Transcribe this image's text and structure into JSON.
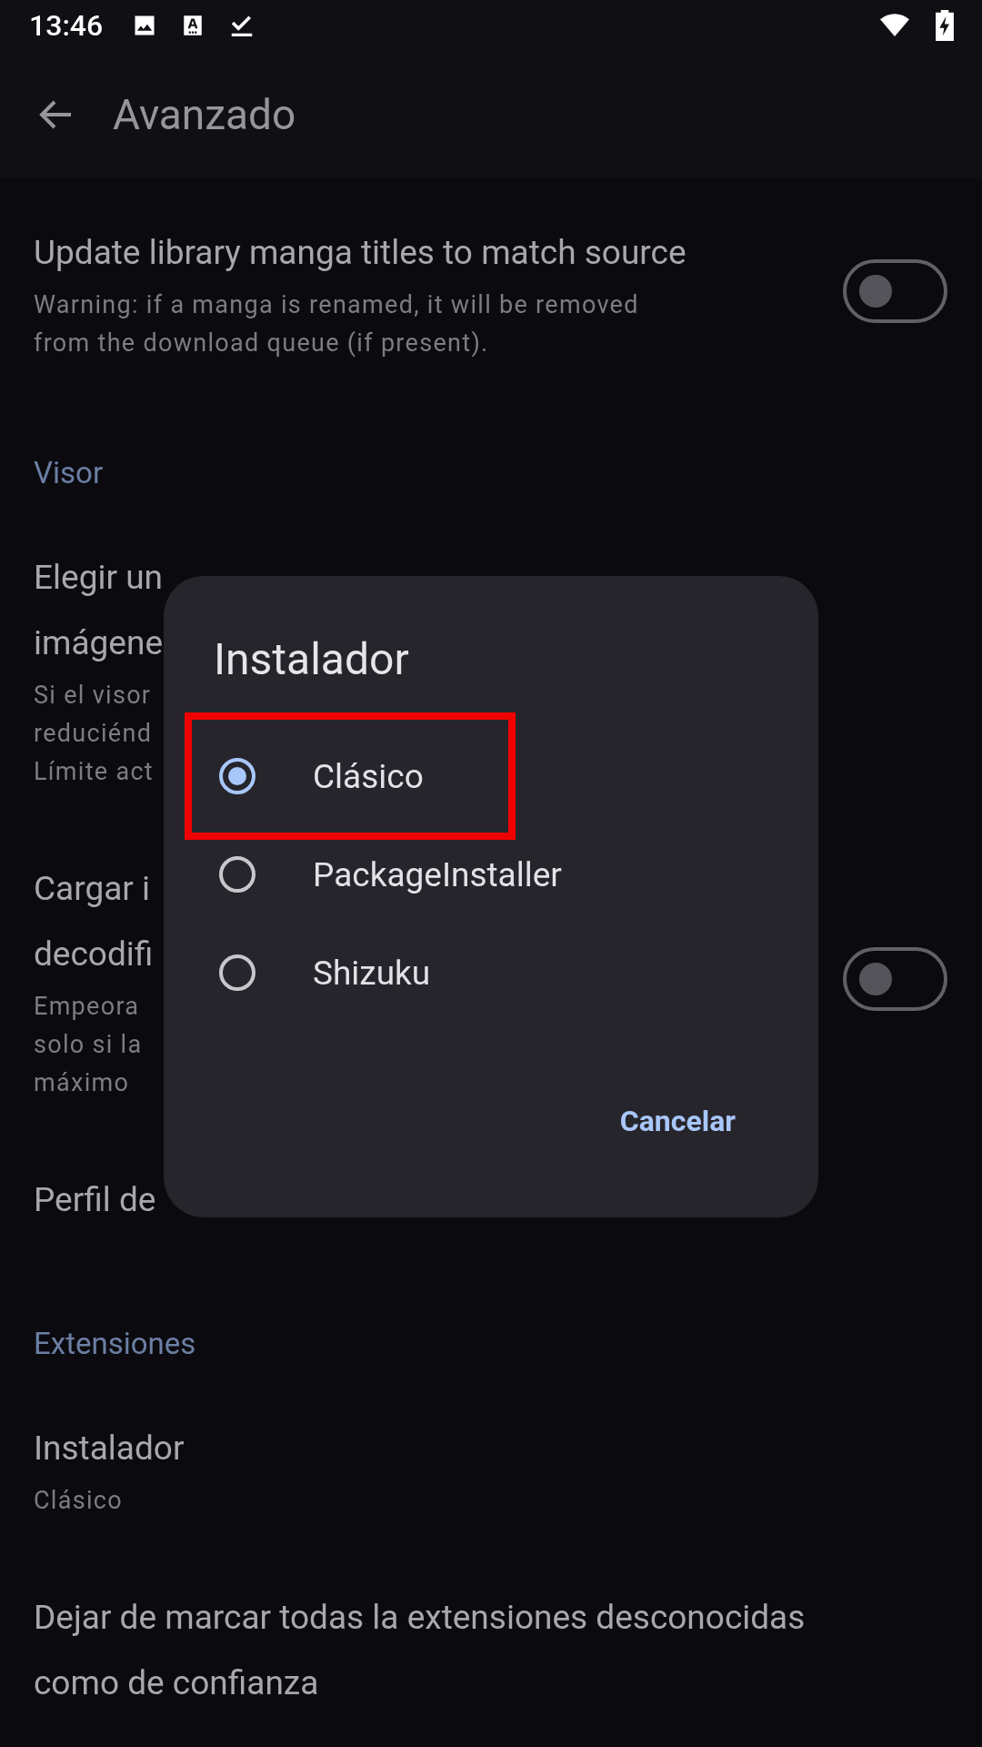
{
  "status_bar": {
    "time": "13:46"
  },
  "toolbar": {
    "title": "Avanzado"
  },
  "settings": [
    {
      "kind": "switch",
      "title_lines": [
        "Update library manga titles to match source"
      ],
      "summary_lines": [
        "Warning: if a manga is renamed, it will be removed",
        "from the download queue (if present)."
      ],
      "on": false
    },
    {
      "kind": "section",
      "title": "Visor"
    },
    {
      "kind": "plain",
      "title_lines": [
        "Elegir un",
        "imágene"
      ],
      "summary_lines": [
        "Si el visor",
        "reduciénd",
        "Límite act"
      ]
    },
    {
      "kind": "switch",
      "title_lines": [
        "Cargar i",
        "decodifi"
      ],
      "summary_lines": [
        "Empeora",
        "solo si la",
        "máximo"
      ],
      "on": false
    },
    {
      "kind": "plain",
      "title_lines": [
        "Perfil de"
      ]
    },
    {
      "kind": "section",
      "title": "Extensiones"
    },
    {
      "kind": "plain",
      "title_lines": [
        "Instalador"
      ],
      "summary_lines": [
        "Clásico"
      ]
    },
    {
      "kind": "plain",
      "title_lines": [
        "Dejar de marcar todas la extensiones desconocidas",
        "como de confianza"
      ]
    }
  ],
  "dialog": {
    "title": "Instalador",
    "options": [
      {
        "label": "Clásico",
        "selected": true,
        "highlighted": true
      },
      {
        "label": "PackageInstaller",
        "selected": false,
        "highlighted": false
      },
      {
        "label": "Shizuku",
        "selected": false,
        "highlighted": false
      }
    ],
    "cancel": "Cancelar"
  }
}
